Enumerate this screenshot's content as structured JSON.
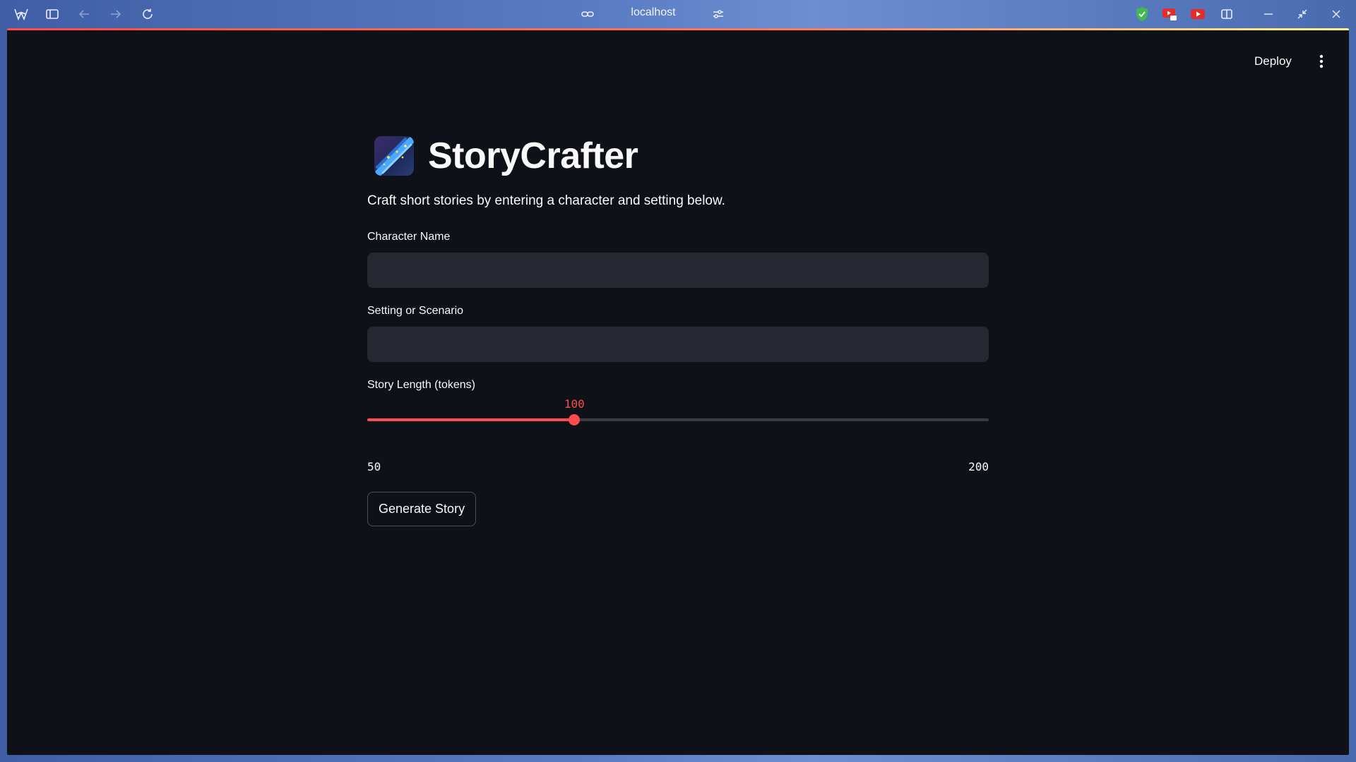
{
  "browser": {
    "url": "localhost",
    "icons": {
      "menu": "wing-logo-icon",
      "sidebar": "sidebar-toggle-icon",
      "back": "arrow-left-icon",
      "forward": "arrow-right-icon",
      "reload": "reload-icon",
      "link": "link-icon",
      "site_settings": "sliders-icon",
      "extensions": [
        "shield-check-icon",
        "youtube-queue-icon",
        "youtube-icon"
      ],
      "split": "split-view-icon",
      "minimize": "minimize-icon",
      "restore": "restore-icon",
      "close": "close-icon"
    }
  },
  "app": {
    "deploy_label": "Deploy",
    "menu_icon": "kebab-menu-icon",
    "title": "StoryCrafter",
    "logo_icon": "shooting-star-icon",
    "subtitle": "Craft short stories by entering a character and setting below.",
    "fields": {
      "character": {
        "label": "Character Name",
        "value": ""
      },
      "setting": {
        "label": "Setting or Scenario",
        "value": ""
      }
    },
    "slider": {
      "label": "Story Length (tokens)",
      "min": 50,
      "max": 200,
      "value": 100,
      "min_label": "50",
      "max_label": "200",
      "value_label": "100"
    },
    "generate_label": "Generate Story",
    "colors": {
      "background": "#0e1117",
      "accent": "#ff4b4b",
      "input_bg": "#262730",
      "text": "#fafafa"
    }
  }
}
